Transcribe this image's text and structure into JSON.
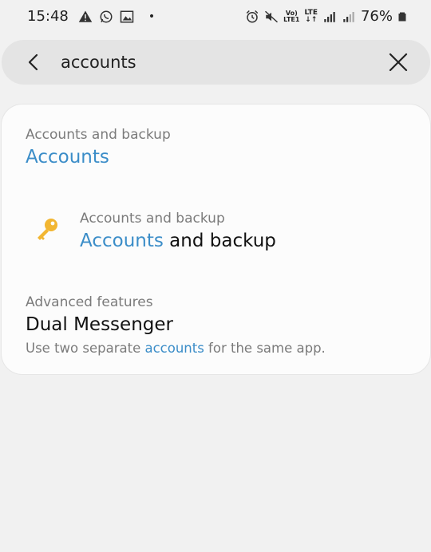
{
  "status_bar": {
    "time": "15:48",
    "volte_top": "Vo)",
    "volte_bottom": "LTE1",
    "lte": "LTE",
    "battery": "76%",
    "icons": [
      "warning-icon",
      "whatsapp-icon",
      "gallery-icon",
      "alarm-icon",
      "mute-icon",
      "signal-icon",
      "battery-icon"
    ]
  },
  "search": {
    "query": "accounts",
    "back_icon": "back-arrow-icon",
    "clear_icon": "close-icon"
  },
  "colors": {
    "highlight": "#3b8dc8",
    "key_icon": "#f2b632",
    "card_bg": "#fcfcfc",
    "page_bg": "#f1f1f1"
  },
  "results": [
    {
      "category": "Accounts and backup",
      "title_highlight": "Accounts",
      "title_rest": ""
    },
    {
      "category": "Accounts and backup",
      "title_highlight": "Accounts",
      "title_rest": " and backup",
      "icon": "key-icon"
    },
    {
      "category": "Advanced features",
      "title": "Dual Messenger",
      "subtitle_before": "Use two separate ",
      "subtitle_highlight": "accounts",
      "subtitle_after": " for the same app."
    }
  ]
}
